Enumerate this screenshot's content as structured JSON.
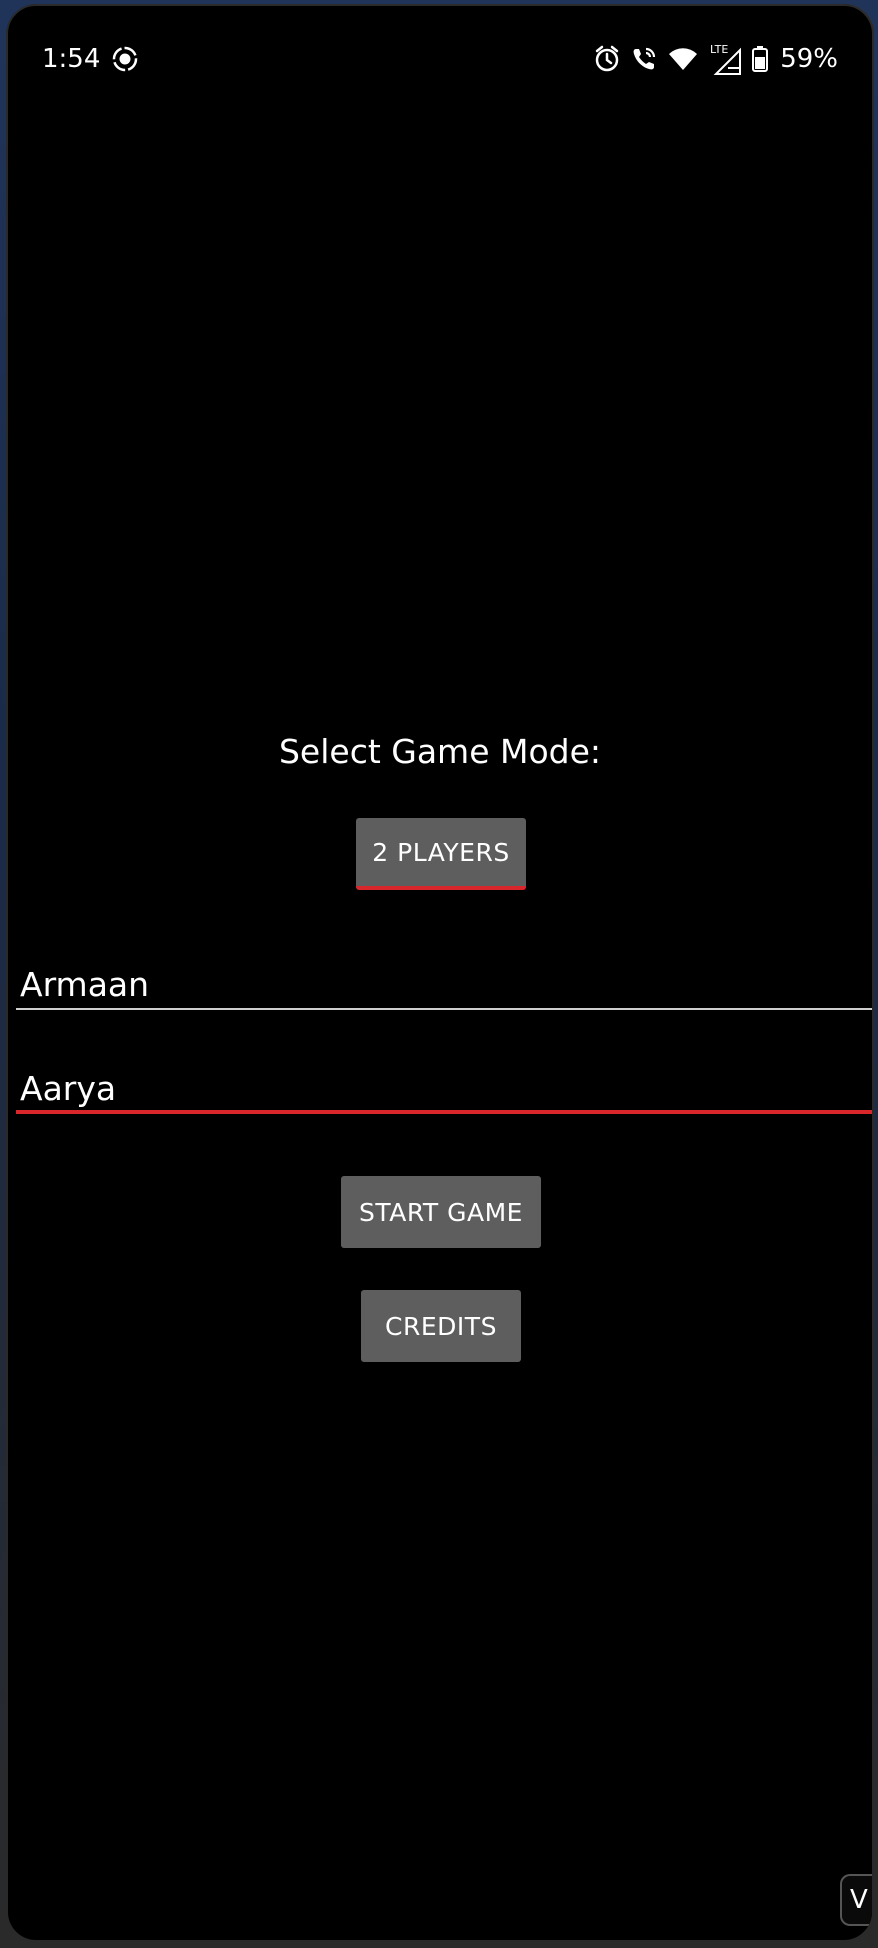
{
  "status_bar": {
    "time": "1:54",
    "network": "LTE",
    "battery": "59%",
    "icons": [
      "screen-record-icon",
      "alarm-icon",
      "wifi-calling-icon",
      "wifi-icon",
      "cellular-signal-icon",
      "battery-icon"
    ]
  },
  "game": {
    "mode_label": "Select Game Mode:",
    "mode_button": "2 PLAYERS",
    "player1_name": "Armaan",
    "player2_name": "Aarya",
    "start_button": "START GAME",
    "credits_button": "CREDITS"
  },
  "overlay": {
    "corner_tab_text": "V"
  },
  "colors": {
    "background": "#000000",
    "button": "#5e5e5e",
    "accent": "#d8262a",
    "text": "#ffffff"
  }
}
